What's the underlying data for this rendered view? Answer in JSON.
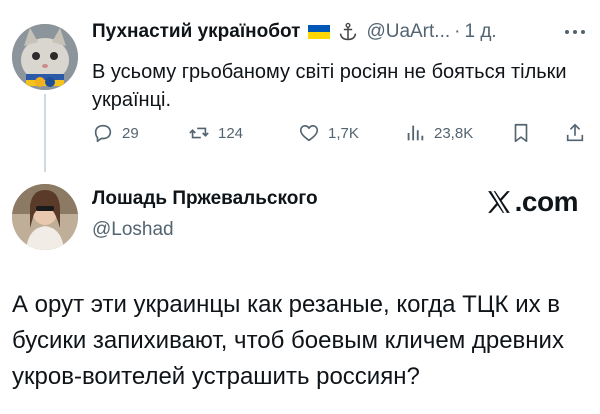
{
  "reply_tweet": {
    "author_name": "Пухнастий українобот",
    "handle": "@UaArt...",
    "separator": "·",
    "time": "1 д.",
    "text": "В усьому грьобаному світі росіян не бояться тільки українці.",
    "icons": [
      "ukraine-flag",
      "anchor",
      "more-dots",
      "reply",
      "retweet",
      "like",
      "views",
      "bookmark",
      "share"
    ],
    "stats": {
      "replies": "29",
      "retweets": "124",
      "likes": "1,7K",
      "views": "23,8K"
    },
    "flag_colors": {
      "top": "#0057B7",
      "bottom": "#FFD700"
    }
  },
  "quoted_tweet": {
    "author_name": "Лошадь Пржевальского",
    "handle": "@Loshad",
    "site_label": ".com",
    "text": "А орут эти украинцы как резаные, когда ТЦК их в бусики запихивают, чтоб боевым кличем древних укров-воителей устрашить россиян?"
  },
  "colors": {
    "text": "#0f1419",
    "muted": "#536471",
    "line": "#cfd9de"
  }
}
